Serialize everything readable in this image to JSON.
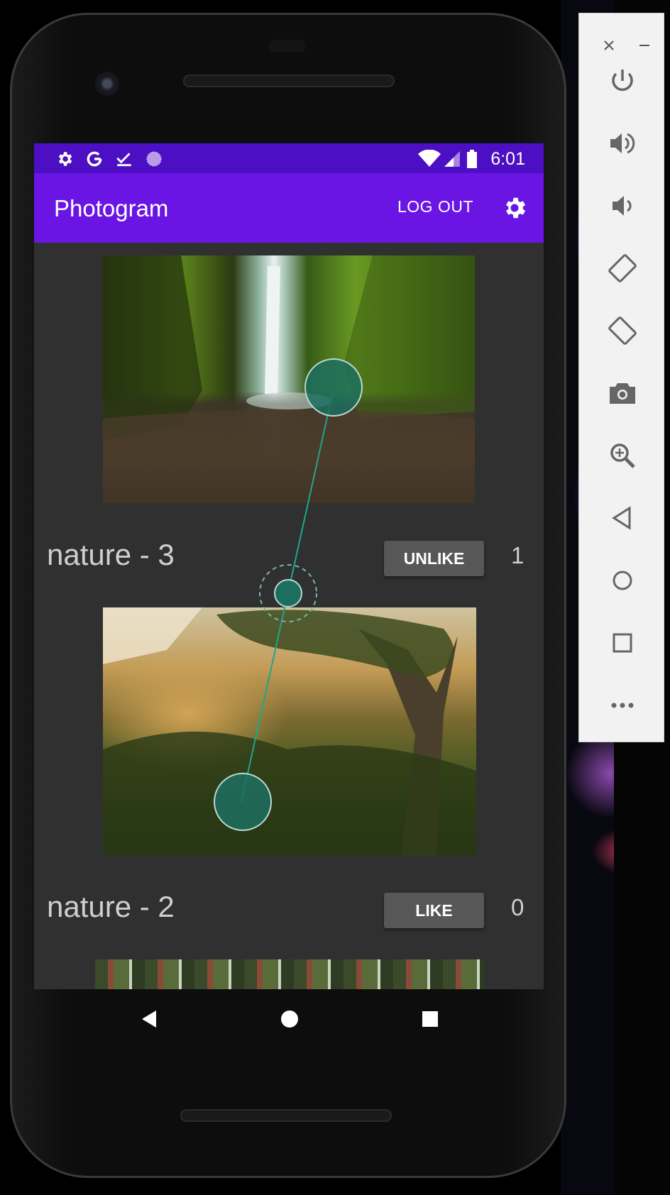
{
  "status_bar": {
    "time": "6:01",
    "left_icons": [
      "gear-icon",
      "google-g-icon",
      "checklist-icon",
      "circle-dots-icon"
    ],
    "right_icons": [
      "wifi-icon",
      "signal-icon",
      "battery-icon"
    ]
  },
  "app_bar": {
    "title": "Photogram",
    "logout_label": "LOG OUT",
    "settings_icon": "gear-icon"
  },
  "feed": {
    "posts": [
      {
        "title": "nature - 3",
        "button_label": "UNLIKE",
        "count": "1"
      },
      {
        "title": "nature - 2",
        "button_label": "LIKE",
        "count": "0"
      }
    ]
  },
  "fab": {
    "icon": "add-photo-icon"
  },
  "colors": {
    "status_bar": "#4c0fc4",
    "app_bar": "#6a15e4",
    "background": "#303030",
    "fab": "#11c6b4",
    "touch": "#1d8a7a"
  },
  "nav_bar": {
    "icons": [
      "back-icon",
      "home-icon",
      "recents-icon"
    ]
  },
  "emulator_panel": {
    "top_icons": [
      "close-icon",
      "minimize-icon"
    ],
    "buttons": [
      "power-icon",
      "volume-up-icon",
      "volume-down-icon",
      "rotate-left-icon",
      "rotate-right-icon",
      "camera-icon",
      "zoom-icon",
      "back-icon",
      "home-icon",
      "overview-icon",
      "more-icon"
    ]
  }
}
